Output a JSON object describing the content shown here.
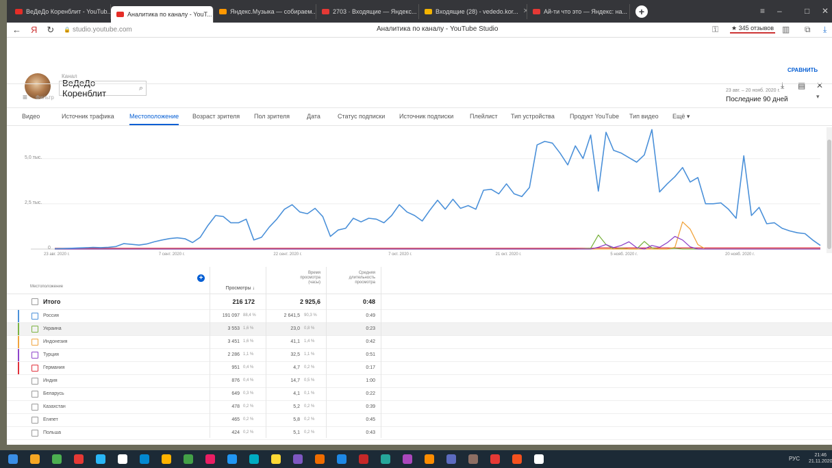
{
  "browser": {
    "tabs": [
      {
        "label": "ВеДеДо Коренблит - YouTub...",
        "color": "#e52d27",
        "active": false
      },
      {
        "label": "Аналитика по каналу - YouT...",
        "color": "#e52d27",
        "active": true
      },
      {
        "label": "Яндекс.Музыка — собираем...",
        "color": "#ff9800",
        "active": false
      },
      {
        "label": "2703 · Входящие — Яндекс...",
        "color": "#e53935",
        "active": false
      },
      {
        "label": "Входящие (28) - vededo.kor...",
        "color": "#f4b400",
        "active": false
      },
      {
        "label": "Ай-ти что это — Яндекс: на...",
        "color": "#e53935",
        "active": false
      }
    ],
    "newtab": "+",
    "url": "studio.youtube.com",
    "page_title": "Аналитика по каналу - YouTube Studio",
    "reviews": "★ 345 отзывов",
    "nav_back": "←",
    "nav_ya": "Я",
    "nav_reload": "↻",
    "lock": "🔒"
  },
  "studio": {
    "channel_caption": "Канал",
    "channel_name": "ВеДеДо Коренблит",
    "search_glyph": "⌕",
    "compare": "СРАВНИТЬ",
    "download_glyph": "⤓",
    "feedback_glyph": "▤",
    "close_glyph": "✕",
    "filter_label": "Фильтр",
    "filter_glyph": "≡",
    "period_range": "23 авг. – 20 нояб. 2020 г.",
    "period_label": "Последние 90 дней",
    "period_caret": "▾"
  },
  "analytics_tabs": [
    {
      "label": "Видео",
      "selected": false
    },
    {
      "label": "Источник трафика",
      "selected": false
    },
    {
      "label": "Местоположение",
      "selected": true
    },
    {
      "label": "Возраст зрителя",
      "selected": false
    },
    {
      "label": "Пол зрителя",
      "selected": false
    },
    {
      "label": "Дата",
      "selected": false
    },
    {
      "label": "Статус подписки",
      "selected": false
    },
    {
      "label": "Источник подписки",
      "selected": false
    },
    {
      "label": "Плейлист",
      "selected": false
    },
    {
      "label": "Тип устройства",
      "selected": false
    },
    {
      "label": "Продукт YouTube",
      "selected": false
    },
    {
      "label": "Тип видео",
      "selected": false
    },
    {
      "label": "Ещё ▾",
      "selected": false
    }
  ],
  "chart_data": {
    "type": "line",
    "yticks": [
      "5,0 тыс.",
      "2,5 тыс.",
      "0"
    ],
    "ytick_values": [
      5000,
      2500,
      0
    ],
    "ylim": [
      0,
      6500
    ],
    "xticks": [
      "23 авг. 2020 г.",
      "7 сент. 2020 г.",
      "22 сент. 2020 г.",
      "7 окт. 2020 г.",
      "21 окт. 2020 г.",
      "5 нояб. 2020 г.",
      "20 нояб. 2020 г."
    ],
    "xtick_index": [
      0,
      15,
      30,
      45,
      59,
      74,
      89
    ],
    "series": [
      {
        "color": "#4a90d9",
        "values": [
          20,
          25,
          40,
          60,
          70,
          90,
          80,
          100,
          140,
          300,
          260,
          220,
          280,
          400,
          500,
          580,
          620,
          570,
          360,
          650,
          1300,
          1850,
          1800,
          1450,
          1450,
          1650,
          500,
          650,
          1200,
          1650,
          2200,
          2450,
          2050,
          1950,
          2250,
          1800,
          700,
          1050,
          1150,
          1700,
          1500,
          1700,
          1650,
          1450,
          1850,
          2450,
          2050,
          1850,
          1550,
          2150,
          2700,
          2200,
          2750,
          2250,
          2400,
          2200,
          3250,
          3300,
          3050,
          3600,
          3050,
          2900,
          3400,
          5750,
          5950,
          5850,
          5300,
          4650,
          5700,
          5000,
          6300,
          3200,
          6450,
          5450,
          5300,
          5050,
          4800,
          5200,
          6600,
          3150,
          3600,
          4000,
          4500,
          3700,
          3950,
          2500,
          2500,
          2550,
          2200,
          1700,
          5150,
          1850,
          2300,
          1400,
          1450,
          1150,
          1000,
          900,
          850,
          500,
          200
        ]
      },
      {
        "color": "#7cb342",
        "values": [
          0,
          0,
          0,
          0,
          0,
          0,
          0,
          0,
          0,
          0,
          0,
          0,
          0,
          0,
          0,
          0,
          0,
          0,
          0,
          0,
          0,
          0,
          0,
          0,
          0,
          0,
          0,
          0,
          0,
          0,
          0,
          0,
          0,
          0,
          0,
          0,
          0,
          0,
          0,
          0,
          0,
          0,
          0,
          0,
          0,
          0,
          0,
          0,
          0,
          0,
          0,
          0,
          0,
          0,
          0,
          0,
          0,
          0,
          0,
          0,
          0,
          0,
          0,
          0,
          0,
          0,
          0,
          0,
          0,
          20,
          40,
          780,
          250,
          0,
          40,
          0,
          0,
          420,
          60,
          0,
          0,
          40,
          0,
          0,
          0,
          0,
          0,
          0,
          0,
          0,
          0,
          0,
          0,
          0,
          0,
          0,
          0,
          0,
          0,
          0,
          0
        ]
      },
      {
        "color": "#f0a33c",
        "values": [
          0,
          0,
          0,
          0,
          0,
          0,
          0,
          0,
          0,
          0,
          0,
          0,
          0,
          0,
          0,
          0,
          0,
          0,
          0,
          0,
          0,
          0,
          0,
          0,
          0,
          0,
          0,
          0,
          0,
          0,
          0,
          0,
          0,
          0,
          0,
          0,
          0,
          0,
          0,
          0,
          0,
          0,
          0,
          0,
          0,
          0,
          0,
          0,
          0,
          0,
          0,
          0,
          0,
          0,
          0,
          0,
          0,
          0,
          0,
          0,
          0,
          0,
          0,
          0,
          0,
          0,
          0,
          0,
          0,
          0,
          0,
          0,
          0,
          0,
          0,
          0,
          0,
          0,
          0,
          0,
          0,
          100,
          1500,
          1100,
          250,
          0,
          0,
          0,
          0,
          0,
          0,
          0,
          0,
          0,
          0,
          0,
          0,
          0,
          0,
          0,
          0
        ]
      },
      {
        "color": "#8e44c9",
        "values": [
          0,
          0,
          0,
          0,
          0,
          0,
          0,
          0,
          0,
          0,
          0,
          0,
          0,
          0,
          0,
          0,
          0,
          0,
          0,
          0,
          0,
          0,
          0,
          0,
          0,
          0,
          0,
          0,
          0,
          0,
          0,
          0,
          0,
          0,
          0,
          0,
          0,
          0,
          0,
          0,
          0,
          0,
          0,
          0,
          0,
          0,
          0,
          0,
          0,
          0,
          0,
          0,
          0,
          0,
          0,
          0,
          0,
          0,
          0,
          0,
          0,
          0,
          0,
          0,
          0,
          0,
          0,
          0,
          0,
          0,
          0,
          100,
          250,
          80,
          200,
          400,
          80,
          0,
          200,
          100,
          350,
          700,
          500,
          120,
          0,
          0,
          0,
          0,
          0,
          0,
          0,
          0,
          0,
          0,
          0,
          0,
          0,
          0,
          0,
          0,
          0
        ]
      },
      {
        "color": "#e0303a",
        "values": [
          40,
          40,
          40,
          40,
          40,
          40,
          40,
          40,
          40,
          40,
          40,
          40,
          40,
          40,
          40,
          40,
          40,
          40,
          40,
          40,
          40,
          40,
          40,
          40,
          40,
          40,
          40,
          40,
          40,
          40,
          40,
          40,
          40,
          40,
          40,
          40,
          40,
          40,
          40,
          40,
          40,
          40,
          40,
          40,
          40,
          40,
          40,
          40,
          40,
          40,
          40,
          40,
          40,
          40,
          40,
          40,
          40,
          40,
          40,
          40,
          40,
          40,
          40,
          40,
          40,
          40,
          40,
          40,
          40,
          40,
          40,
          60,
          60,
          60,
          60,
          60,
          60,
          60,
          60,
          60,
          60,
          60,
          60,
          60,
          60,
          60,
          60,
          60,
          60,
          60,
          60,
          60,
          60,
          60,
          60,
          60,
          60,
          60,
          60,
          60,
          60
        ]
      }
    ]
  },
  "table": {
    "headers": {
      "location": "Местоположение",
      "views": "Просмотры ↓",
      "watch_time": "Время просмотра (часы)",
      "avg_duration": "Средняя длительность просмотра"
    },
    "add_column": "+",
    "total": {
      "label": "Итого",
      "views": "216 172",
      "watch_time": "2 925,6",
      "avg": "0:48"
    },
    "rows": [
      {
        "country": "Россия",
        "views": "191 097",
        "views_pct": "88,4 %",
        "watch_time": "2 641,5",
        "watch_pct": "90,3 %",
        "avg": "0:49",
        "color": "#4a90d9",
        "highlight": false
      },
      {
        "country": "Украина",
        "views": "3 553",
        "views_pct": "1,6 %",
        "watch_time": "23,0",
        "watch_pct": "0,8 %",
        "avg": "0:23",
        "color": "#7cb342",
        "highlight": true
      },
      {
        "country": "Индонезия",
        "views": "3 451",
        "views_pct": "1,6 %",
        "watch_time": "41,1",
        "watch_pct": "1,4 %",
        "avg": "0:42",
        "color": "#f0a33c",
        "highlight": false
      },
      {
        "country": "Турция",
        "views": "2 286",
        "views_pct": "1,1 %",
        "watch_time": "32,5",
        "watch_pct": "1,1 %",
        "avg": "0:51",
        "color": "#8e44c9",
        "highlight": false
      },
      {
        "country": "Германия",
        "views": "951",
        "views_pct": "0,4 %",
        "watch_time": "4,7",
        "watch_pct": "0,2 %",
        "avg": "0:17",
        "color": "#e0303a",
        "highlight": false
      },
      {
        "country": "Индия",
        "views": "876",
        "views_pct": "0,4 %",
        "watch_time": "14,7",
        "watch_pct": "0,5 %",
        "avg": "1:00",
        "color": "",
        "highlight": false
      },
      {
        "country": "Беларусь",
        "views": "649",
        "views_pct": "0,3 %",
        "watch_time": "4,1",
        "watch_pct": "0,1 %",
        "avg": "0:22",
        "color": "",
        "highlight": false
      },
      {
        "country": "Казахстан",
        "views": "478",
        "views_pct": "0,2 %",
        "watch_time": "5,2",
        "watch_pct": "0,2 %",
        "avg": "0:39",
        "color": "",
        "highlight": false
      },
      {
        "country": "Египет",
        "views": "465",
        "views_pct": "0,2 %",
        "watch_time": "5,8",
        "watch_pct": "0,2 %",
        "avg": "0:45",
        "color": "",
        "highlight": false
      },
      {
        "country": "Польша",
        "views": "424",
        "views_pct": "0,2 %",
        "watch_time": "5,1",
        "watch_pct": "0,2 %",
        "avg": "0:43",
        "color": "",
        "highlight": false
      }
    ]
  },
  "taskbar": {
    "lang": "РУС",
    "time": "21:46",
    "date": "21.11.2020"
  }
}
